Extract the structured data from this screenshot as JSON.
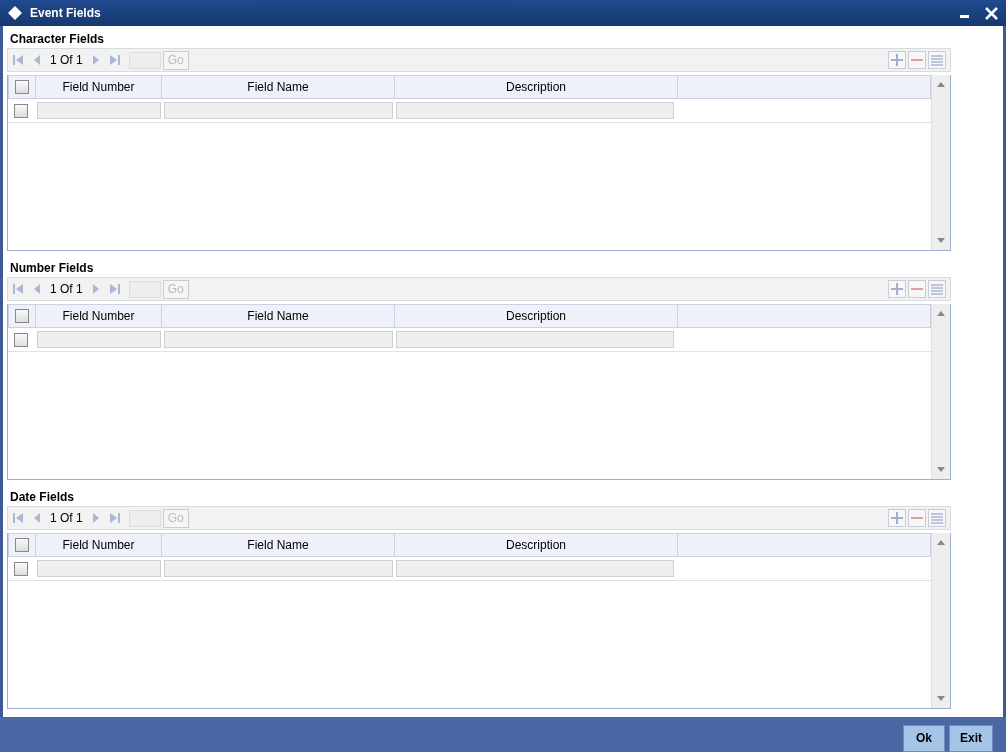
{
  "window": {
    "title": "Event Fields"
  },
  "sections": [
    {
      "title": "Character Fields",
      "pager": {
        "page": "1 Of 1",
        "go": "Go"
      },
      "columns": [
        "Field Number",
        "Field Name",
        "Description"
      ],
      "select_all": {
        "checked": false
      },
      "rows": [
        {
          "checked": false
        }
      ]
    },
    {
      "title": "Number Fields",
      "pager": {
        "page": "1 Of 1",
        "go": "Go"
      },
      "columns": [
        "Field Number",
        "Field Name",
        "Description"
      ],
      "select_all": {
        "checked": false
      },
      "rows": [
        {
          "checked": false
        }
      ]
    },
    {
      "title": "Date Fields",
      "pager": {
        "page": "1 Of 1",
        "go": "Go"
      },
      "columns": [
        "Field Number",
        "Field Name",
        "Description"
      ],
      "select_all": {
        "checked": false
      },
      "rows": [
        {
          "checked": false
        }
      ]
    }
  ],
  "buttons": [
    "Ok",
    "Exit"
  ]
}
